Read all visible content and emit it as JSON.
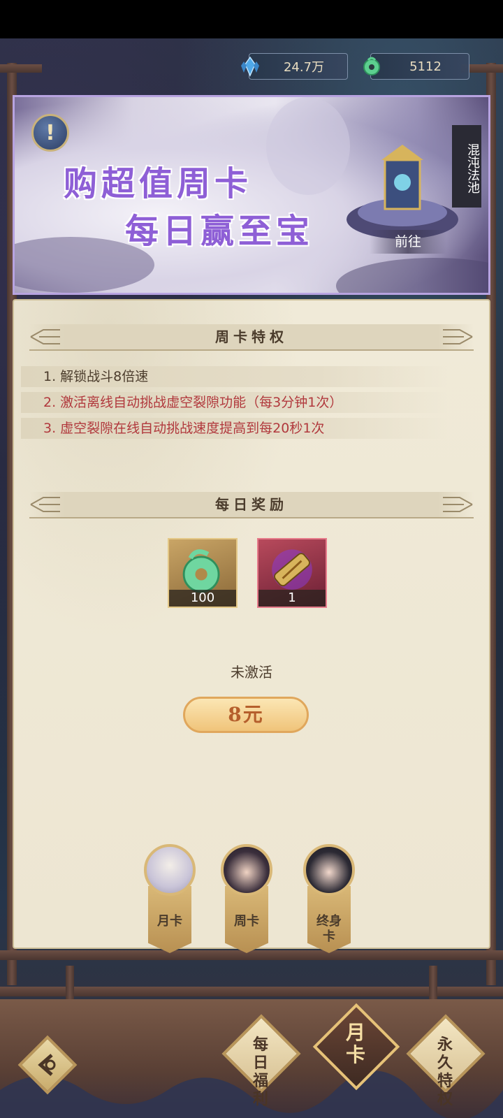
{
  "currency": {
    "crystal": "24.7万",
    "jade": "5112"
  },
  "banner": {
    "line1": "购超值周卡",
    "line2": "每日赢至宝",
    "side_label": "混沌法池",
    "goto_label": "前往",
    "info_glyph": "!"
  },
  "privileges": {
    "title": "周卡特权",
    "items": [
      "1. 解锁战斗8倍速",
      "2. 激活离线自动挑战虚空裂隙功能（每3分钟1次）",
      "3. 虚空裂隙在线自动挑战速度提高到每20秒1次"
    ]
  },
  "rewards": {
    "title": "每日奖励",
    "items": [
      {
        "icon": "jade-pendant-icon",
        "count": "100"
      },
      {
        "icon": "scroll-icon",
        "count": "1"
      }
    ]
  },
  "status": "未激活",
  "price": "8元",
  "card_tabs": [
    {
      "label": "月卡"
    },
    {
      "label": "周卡"
    },
    {
      "label": "终身卡"
    }
  ],
  "bottom_nav": {
    "daily": "每日福利",
    "monthly": "月卡",
    "permanent": "永久特权"
  },
  "colors": {
    "banner_border": "#b7a3e0",
    "title_purple": "#8e5fd6",
    "red_text": "#b1393d",
    "gold": "#d9b877"
  }
}
